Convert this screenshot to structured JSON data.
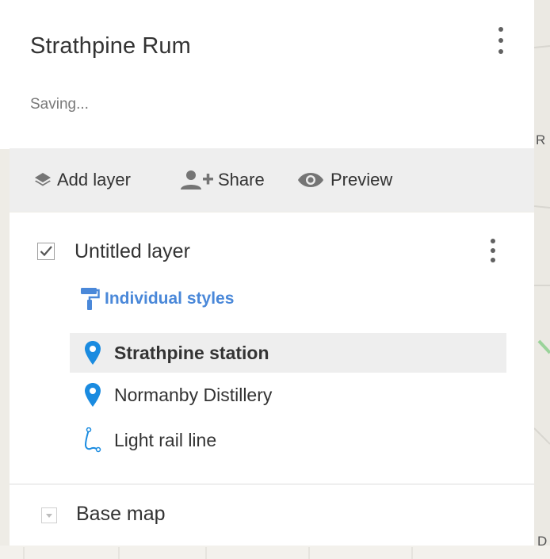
{
  "map": {
    "title": "Strathpine Rum",
    "status": "Saving...",
    "edge_labels": [
      "R",
      "D"
    ]
  },
  "toolbar": {
    "add_layer_label": "Add layer",
    "share_label": "Share",
    "preview_label": "Preview"
  },
  "layer": {
    "name": "Untitled layer",
    "checked": true,
    "styles_label": "Individual styles",
    "features": [
      {
        "label": "Strathpine station",
        "icon": "map-pin-icon",
        "selected": true
      },
      {
        "label": "Normanby Distillery",
        "icon": "map-pin-icon",
        "selected": false
      },
      {
        "label": "Light rail line",
        "icon": "line-path-icon",
        "selected": false
      }
    ]
  },
  "basemap": {
    "label": "Base map"
  },
  "colors": {
    "accent_blue": "#4a88d9",
    "pin_blue": "#1a8be0",
    "selected_bg": "#eeeeee",
    "toolbar_bg": "#eeeeee"
  }
}
